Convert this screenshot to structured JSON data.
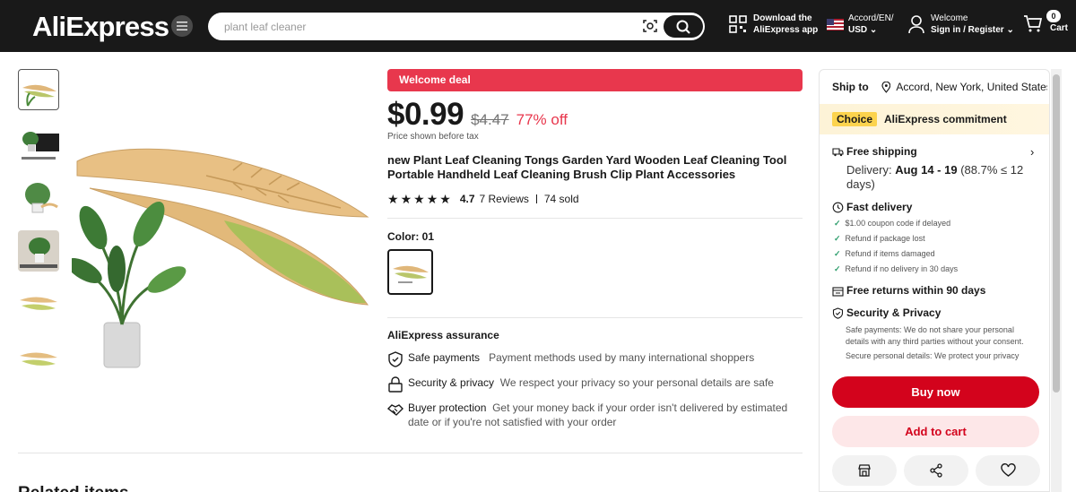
{
  "header": {
    "logo": "AliExpress",
    "search_placeholder": "plant leaf cleaner",
    "app_download": [
      "Download the",
      "AliExpress app"
    ],
    "lang_line1": "Accord/EN/",
    "lang_line2": "USD",
    "welcome_line1": "Welcome",
    "welcome_line2": "Sign in / Register",
    "cart_count": "0",
    "cart_label": "Cart"
  },
  "product": {
    "welcome_deal": "Welcome deal",
    "price_now": "$0.99",
    "price_old": "$4.47",
    "discount": "77% off",
    "price_note": "Price shown before tax",
    "title": "new Plant Leaf Cleaning Tongs Garden Yard Wooden Leaf Cleaning Tool Portable Handheld Leaf Cleaning Brush Clip Plant Accessories",
    "rating_value": "4.7",
    "rating_fraction": 0.94,
    "reviews": "7 Reviews",
    "sold": "74 sold",
    "color_label": "Color: 01"
  },
  "assurance": {
    "title": "AliExpress assurance",
    "items": [
      {
        "title": "Safe payments",
        "desc": "Payment methods used by many international shoppers"
      },
      {
        "title": "Security & privacy",
        "desc": "We respect your privacy so your personal details are safe"
      },
      {
        "title": "Buyer protection",
        "desc": "Get your money back if your order isn't delivered by estimated date or if you're not satisfied with your order"
      }
    ]
  },
  "related_title": "Related items",
  "panel": {
    "ship_to_label": "Ship to",
    "ship_to_location": "Accord, New York, United States",
    "choice_badge": "Choice",
    "choice_text": "AliExpress commitment",
    "free_shipping": "Free shipping",
    "delivery_prefix": "Delivery:",
    "delivery_dates": "Aug 14 - 19",
    "delivery_suffix": "(88.7% ≤ 12 days)",
    "fast_delivery": "Fast delivery",
    "fast_items": [
      "$1.00 coupon code if delayed",
      "Refund if package lost",
      "Refund if items damaged",
      "Refund if no delivery in 30 days"
    ],
    "free_returns": "Free returns within 90 days",
    "security_title": "Security & Privacy",
    "security_text1": "Safe payments: We do not share your personal details with any third parties without your consent.",
    "security_text2": "Secure personal details: We protect your privacy",
    "buy_now": "Buy now",
    "add_to_cart": "Add to cart"
  },
  "colors": {
    "header_bg": "#191919",
    "accent_red": "#e8374d",
    "buy_red": "#d3031c",
    "choice_yellow": "#fcd34d",
    "check_green": "#2d9d6c"
  },
  "icons": [
    "menu-icon",
    "camera-search-icon",
    "search-icon",
    "qr-icon",
    "flag-icon",
    "user-icon",
    "cart-icon",
    "star-icon",
    "location-icon",
    "truck-icon",
    "clock-icon",
    "return-icon",
    "shield-icon",
    "store-icon",
    "share-icon",
    "heart-icon",
    "lock-icon",
    "handshake-icon",
    "chevron-right-icon"
  ]
}
